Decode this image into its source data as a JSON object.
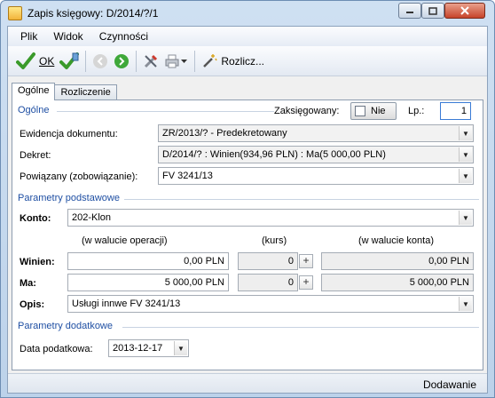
{
  "window": {
    "title": "Zapis księgowy: D/2014/?/1"
  },
  "menu": [
    "Plik",
    "Widok",
    "Czynności"
  ],
  "toolbar": {
    "ok_label": "OK",
    "rozlicz_label": "Rozlicz..."
  },
  "tabs": [
    "Ogólne",
    "Rozliczenie"
  ],
  "general": {
    "section_title": "Ogólne",
    "zaksiegowany_label": "Zaksięgowany:",
    "zaksiegowany_value": "Nie",
    "lp_label": "Lp.:",
    "lp_value": "1",
    "ewidencja_label": "Ewidencja dokumentu:",
    "ewidencja_value": "ZR/2013/? - Predekretowany",
    "dekret_label": "Dekret:",
    "dekret_value": "D/2014/? : Winien(934,96 PLN) : Ma(5 000,00 PLN)",
    "powiazany_label": "Powiązany (zobowiązanie):",
    "powiazany_value": "FV 3241/13"
  },
  "basic": {
    "section_title": "Parametry podstawowe",
    "konto_label": "Konto:",
    "konto_value": "202-Klon",
    "col_operacji": "(w walucie operacji)",
    "col_kurs": "(kurs)",
    "col_konta": "(w walucie konta)",
    "winien_label": "Winien:",
    "winien_value": "0,00 PLN",
    "winien_kurs": "0",
    "winien_konta": "0,00 PLN",
    "ma_label": "Ma:",
    "ma_value": "5 000,00 PLN",
    "ma_kurs": "0",
    "ma_konta": "5 000,00 PLN",
    "opis_label": "Opis:",
    "opis_value": "Usługi innwe FV 3241/13",
    "plus_glyph": "+"
  },
  "extra": {
    "section_title": "Parametry dodatkowe",
    "data_label": "Data podatkowa:",
    "data_value": "2013-12-17"
  },
  "status": {
    "text": "Dodawanie"
  }
}
